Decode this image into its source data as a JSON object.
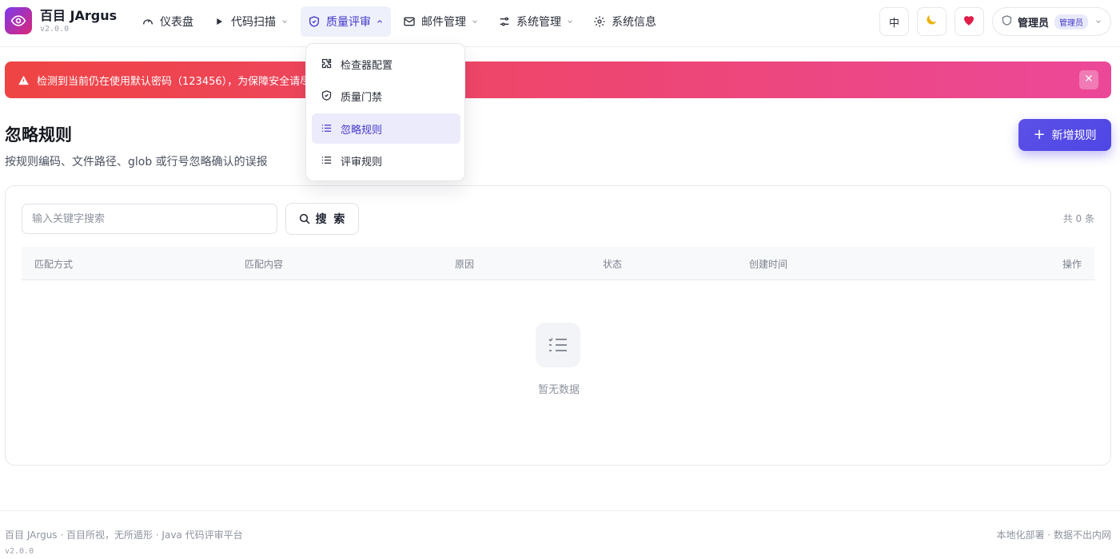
{
  "brand": {
    "name": "百目 JArgus",
    "version": "v2.0.0"
  },
  "nav": {
    "dashboard": "仪表盘",
    "code_scan": "代码扫描",
    "quality_review": "质量评审",
    "mail_mgmt": "邮件管理",
    "system_mgmt": "系统管理",
    "system_info": "系统信息"
  },
  "header_right": {
    "lang": "中",
    "user_name": "管理员",
    "role_badge": "管理员"
  },
  "dropdown": {
    "items": [
      {
        "label": "检查器配置",
        "icon": "puzzle-icon"
      },
      {
        "label": "质量门禁",
        "icon": "shield-icon"
      },
      {
        "label": "忽略规则",
        "icon": "list-icon",
        "active": true
      },
      {
        "label": "评审规则",
        "icon": "list-icon"
      }
    ]
  },
  "alert": {
    "text": "检测到当前仍在使用默认密码（123456），为保障安全请尽"
  },
  "page": {
    "title": "忽略规则",
    "subtitle": "按规则编码、文件路径、glob 或行号忽略确认的误报",
    "add_button": "新增规则"
  },
  "search": {
    "placeholder": "输入关键字搜索",
    "button": "搜 索",
    "total": "共 0 条"
  },
  "table": {
    "columns": [
      "匹配方式",
      "匹配内容",
      "原因",
      "状态",
      "创建时间",
      "操作"
    ],
    "empty_text": "暂无数据"
  },
  "footer": {
    "left": "百目 JArgus · 百目所视，无所遁形 · Java 代码评审平台",
    "right": "本地化部署 · 数据不出内网",
    "version": "v2.0.0"
  },
  "colors": {
    "accent": "#4f46e5",
    "alert_start": "#ef4444",
    "alert_end": "#ec4899",
    "logo_start": "#7c3aed",
    "logo_end": "#db2777"
  }
}
